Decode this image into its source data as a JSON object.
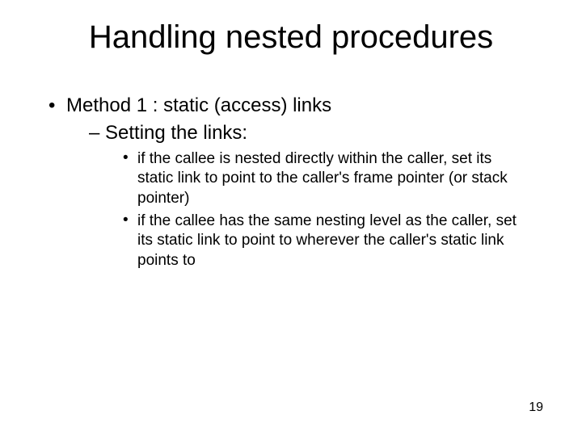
{
  "slide": {
    "title": "Handling nested procedures",
    "l1": "Method 1 : static (access) links",
    "l2": "Setting the links:",
    "l3a": "if the callee is nested directly within the caller, set its static link to point to the caller's frame pointer (or stack pointer)",
    "l3b": "if the callee has the same nesting level as the caller, set its static link to point to wherever the caller's static link points to",
    "page": "19"
  },
  "bullets": {
    "dot": "•",
    "dash": "–"
  }
}
